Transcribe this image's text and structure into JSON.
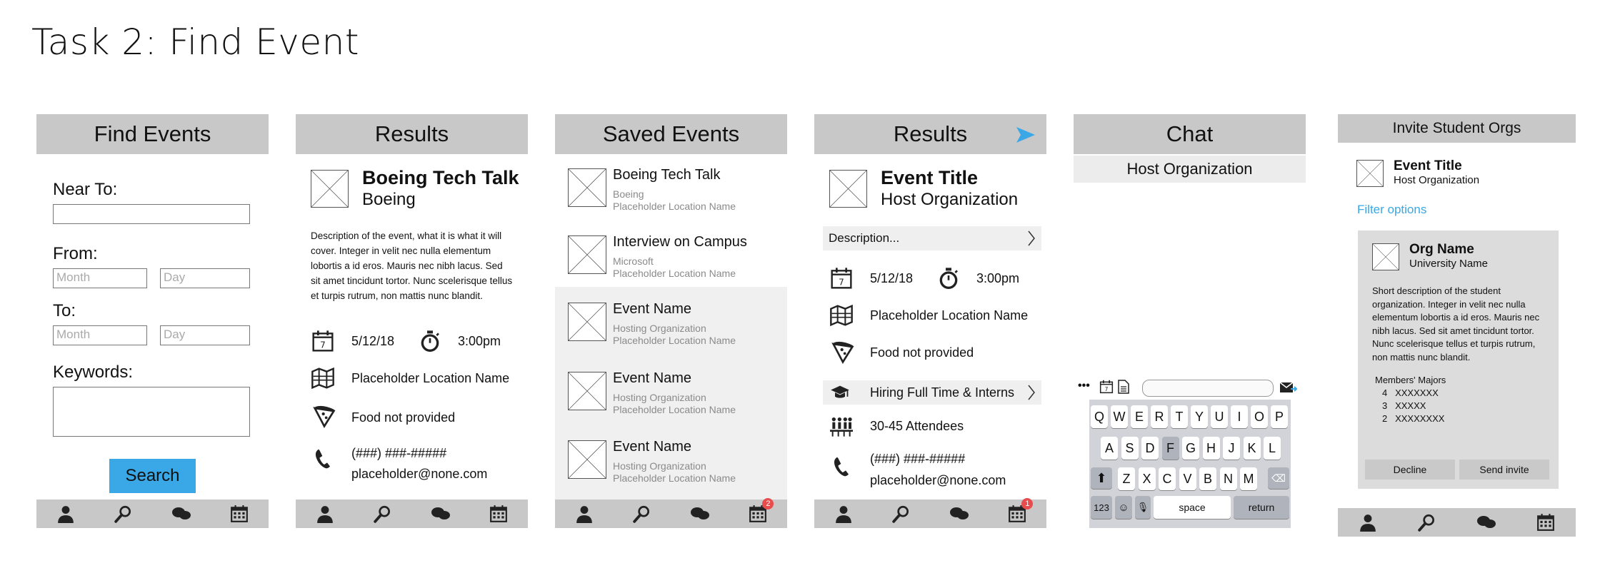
{
  "task_title": "Task 2: Find Event",
  "s1": {
    "header": "Find Events",
    "near_label": "Near To:",
    "from_label": "From:",
    "month_ph": "Month",
    "day_ph": "Day",
    "to_label": "To:",
    "keywords_label": "Keywords:",
    "search_button": "Search"
  },
  "s2": {
    "header": "Results",
    "title": "Boeing Tech Talk",
    "host": "Boeing",
    "description": "Description of the event, what it is what it will cover. Integer in velit nec nulla elementum lobortis a id eros. Mauris nec nibh lacus. Sed sit amet tincidunt tortor. Nunc scelerisque tellus et turpis rutrum, non mattis nunc blandit.",
    "date": "5/12/18",
    "time": "3:00pm",
    "location": "Placeholder Location Name",
    "food": "Food not provided",
    "phone": "(###) ###-#####",
    "email": "placeholder@none.com"
  },
  "s3": {
    "header": "Saved Events",
    "items": [
      {
        "title": "Boeing Tech Talk",
        "org": "Boeing",
        "loc": "Placeholder Location Name"
      },
      {
        "title": "Interview on Campus",
        "org": "Microsoft",
        "loc": "Placeholder Location Name"
      },
      {
        "title": "Event Name",
        "org": "Hosting Organization",
        "loc": "Placeholder Location Name"
      },
      {
        "title": "Event Name",
        "org": "Hosting Organization",
        "loc": "Placeholder Location Name"
      },
      {
        "title": "Event Name",
        "org": "Hosting Organization",
        "loc": "Placeholder Location Name"
      }
    ],
    "badge": "2"
  },
  "s4": {
    "header": "Results",
    "title": "Event Title",
    "host": "Host Organization",
    "description": "Description...",
    "date": "5/12/18",
    "time": "3:00pm",
    "location": "Placeholder Location Name",
    "food": "Food not provided",
    "hiring": "Hiring Full Time & Interns",
    "attendees": "30-45 Attendees",
    "phone": "(###) ###-#####",
    "email": "placeholder@none.com",
    "badge": "1"
  },
  "s5": {
    "header": "Chat",
    "subheader": "Host Organization",
    "keyboard": {
      "row1": [
        "Q",
        "W",
        "E",
        "R",
        "T",
        "Y",
        "U",
        "I",
        "O",
        "P"
      ],
      "row2": [
        "A",
        "S",
        "D",
        "F",
        "G",
        "H",
        "J",
        "K",
        "L"
      ],
      "row3": [
        "Z",
        "X",
        "C",
        "V",
        "B",
        "N",
        "M"
      ],
      "num_key": "123",
      "space_key": "space",
      "return_key": "return"
    }
  },
  "s6": {
    "header": "Invite Student Orgs",
    "title": "Event Title",
    "host": "Host Organization",
    "filter": "Filter options",
    "org_name": "Org Name",
    "university": "University Name",
    "org_desc": "Short description of the student organization. Integer in velit nec nulla elementum lobortis a id eros. Mauris nec nibh lacus. Sed sit amet tincidunt tortor. Nunc scelerisque tellus et turpis rutrum, non mattis nunc blandit.",
    "majors_label": "Members' Majors",
    "majors": [
      {
        "count": "4",
        "name": "XXXXXXX"
      },
      {
        "count": "3",
        "name": "XXXXX"
      },
      {
        "count": "2",
        "name": "XXXXXXXX"
      }
    ],
    "decline": "Decline",
    "send": "Send invite"
  },
  "colors": {
    "accent": "#3aa7e6",
    "header_grey": "#c8c8c8",
    "badge_red": "#e84c4c",
    "keyboard_bg": "#d1d3d8"
  },
  "icons": [
    "person-icon",
    "search-icon",
    "chat-icon",
    "calendar-icon",
    "placeholder-image-icon",
    "date-icon",
    "stopwatch-icon",
    "map-icon",
    "pizza-icon",
    "phone-icon",
    "graduation-cap-icon",
    "attendees-icon",
    "chevron-right-icon",
    "send-arrow-icon"
  ]
}
